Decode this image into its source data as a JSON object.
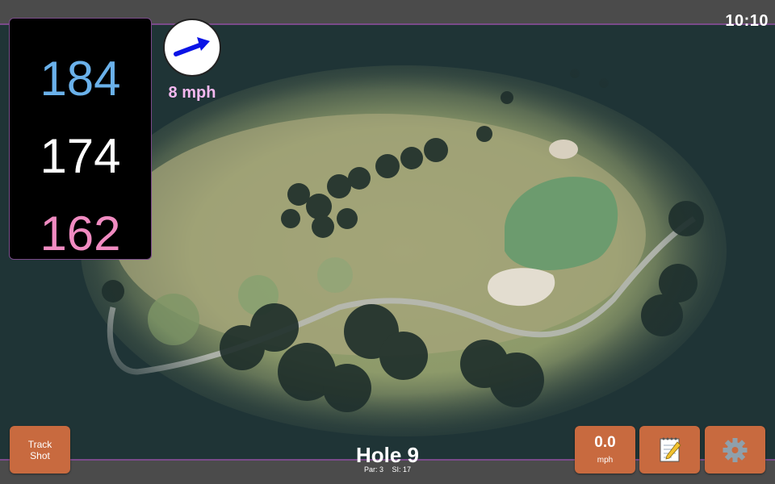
{
  "clock": "10:10",
  "distances": {
    "back": "184",
    "middle": "174",
    "front": "162"
  },
  "wind": {
    "speed_label": "8 mph",
    "arrow_icon": "wind-arrow-icon",
    "arrow_color": "#0b14e6"
  },
  "buttons": {
    "track_shot": "Track\nShot",
    "speed_value": "0.0",
    "speed_unit": "mph",
    "notes_icon": "notepad-icon",
    "settings_icon": "gear-icon"
  },
  "hole": {
    "title": "Hole 9",
    "par": "Par: 3",
    "si": "SI: 17"
  },
  "colors": {
    "back": "#6ab1ea",
    "middle": "#ffffff",
    "front": "#f08bc1",
    "button": "#c86a3f",
    "accent": "#7a4b8a"
  }
}
